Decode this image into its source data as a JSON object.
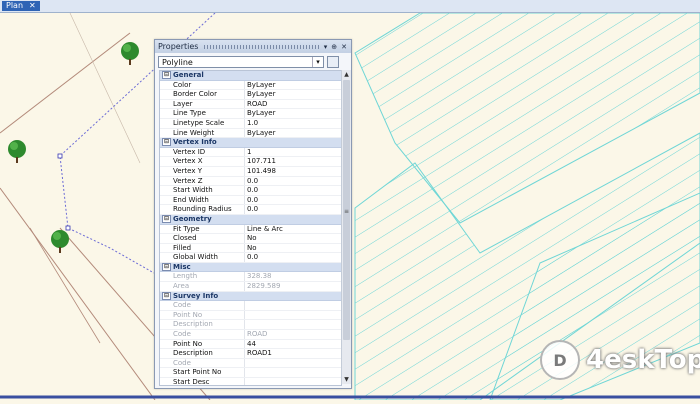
{
  "tab": {
    "label": "Plan",
    "close": "✕"
  },
  "panel": {
    "title": "Properties",
    "controls": {
      "pin": "▾",
      "dock": "⊕",
      "close": "✕"
    },
    "selector_value": "Polyline",
    "selector_arrow": "▾",
    "categories": [
      {
        "name": "General",
        "toggle": "⊟",
        "rows": [
          {
            "label": "Color",
            "value": "ByLayer"
          },
          {
            "label": "Border Color",
            "value": "ByLayer"
          },
          {
            "label": "Layer",
            "value": "ROAD"
          },
          {
            "label": "Line Type",
            "value": "ByLayer"
          },
          {
            "label": "Linetype Scale",
            "value": "1.0"
          },
          {
            "label": "Line Weight",
            "value": "ByLayer"
          }
        ]
      },
      {
        "name": "Vertex Info",
        "toggle": "⊟",
        "rows": [
          {
            "label": "Vertex ID",
            "value": "1"
          },
          {
            "label": "Vertex X",
            "value": "107.711"
          },
          {
            "label": "Vertex Y",
            "value": "101.498"
          },
          {
            "label": "Vertex Z",
            "value": "0.0"
          },
          {
            "label": "Start Width",
            "value": "0.0"
          },
          {
            "label": "End Width",
            "value": "0.0"
          },
          {
            "label": "Rounding Radius",
            "value": "0.0"
          }
        ]
      },
      {
        "name": "Geometry",
        "toggle": "⊟",
        "rows": [
          {
            "label": "Fit Type",
            "value": "Line & Arc"
          },
          {
            "label": "Closed",
            "value": "No"
          },
          {
            "label": "Filled",
            "value": "No"
          },
          {
            "label": "Global Width",
            "value": "0.0"
          }
        ]
      },
      {
        "name": "Misc",
        "toggle": "⊟",
        "rows": [
          {
            "label": "Length",
            "value": "328.38",
            "disabled": true
          },
          {
            "label": "Area",
            "value": "2829.589",
            "disabled": true
          }
        ]
      },
      {
        "name": "Survey Info",
        "toggle": "⊟",
        "rows": [
          {
            "label": "Code",
            "value": "",
            "disabled": true
          },
          {
            "label": "Point No",
            "value": "",
            "disabled": true
          },
          {
            "label": "Description",
            "value": "",
            "disabled": true
          },
          {
            "label": "Code",
            "value": "ROAD",
            "disabled": true
          },
          {
            "label": "Point No",
            "value": "44"
          },
          {
            "label": "Description",
            "value": "ROAD1"
          },
          {
            "label": "Code",
            "value": "",
            "disabled": true
          },
          {
            "label": "Start Point No",
            "value": ""
          },
          {
            "label": "Start Desc",
            "value": ""
          },
          {
            "label": "End Point No",
            "value": ""
          }
        ]
      }
    ]
  },
  "colors": {
    "background": "#fbf7e8",
    "hatch": "#6fd6d6",
    "accent": "#2f64b5",
    "tree": "#2e8a2e"
  },
  "watermark": {
    "text": "4eskTop"
  }
}
